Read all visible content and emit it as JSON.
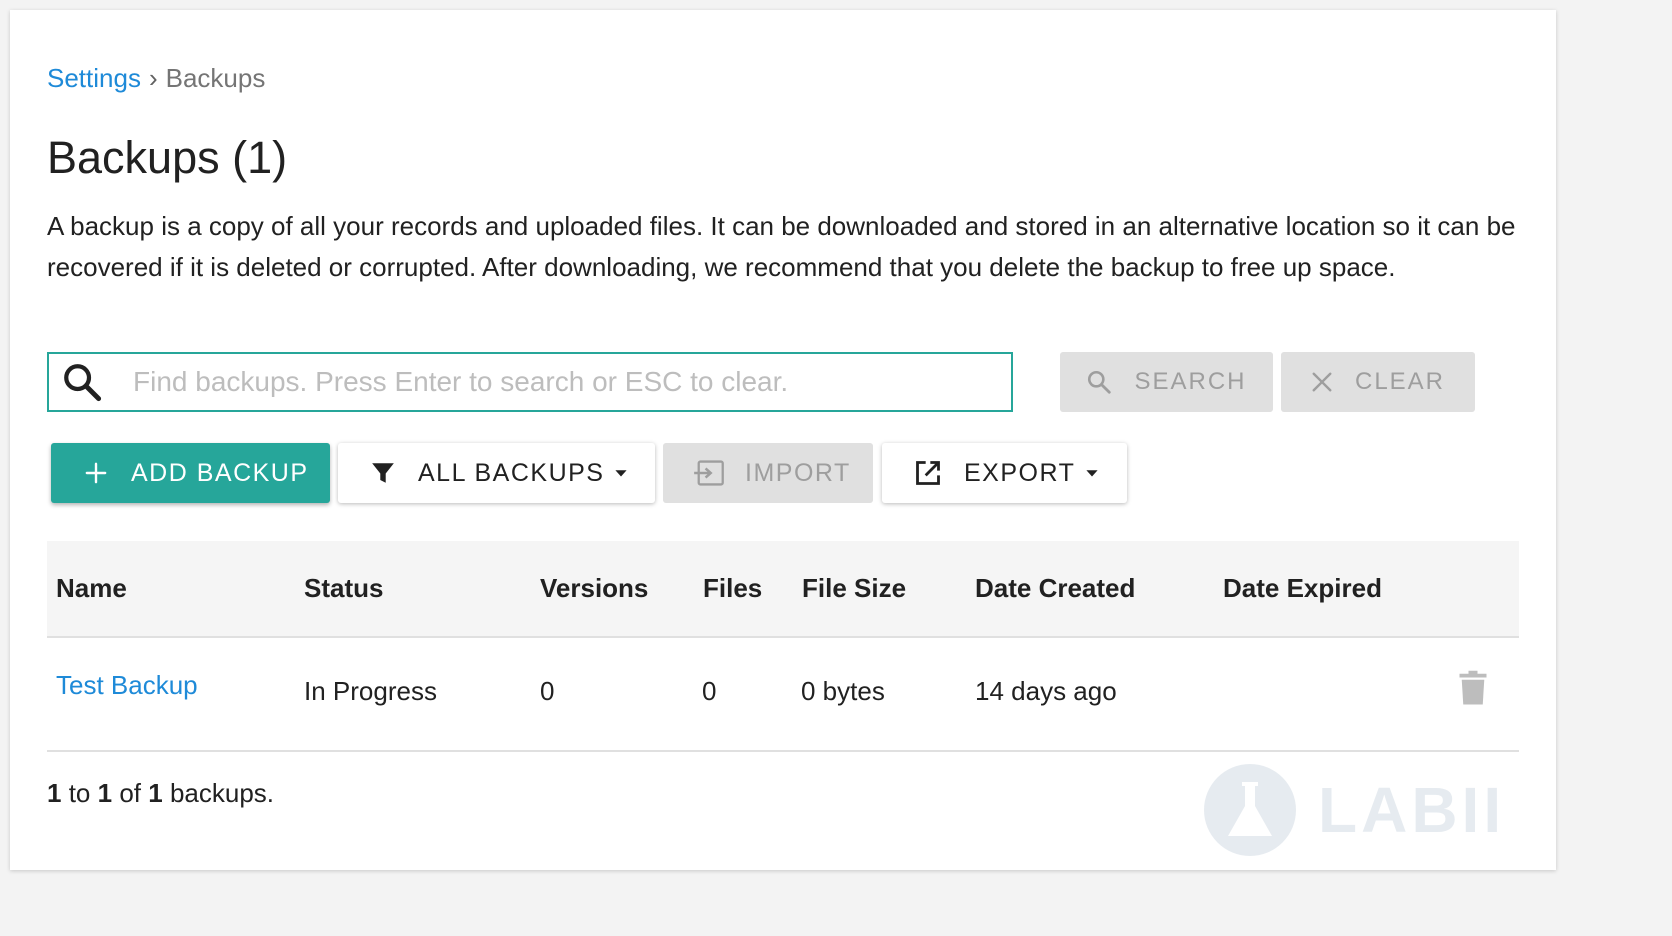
{
  "breadcrumb": {
    "parent": "Settings",
    "separator": "›",
    "current": "Backups"
  },
  "page": {
    "title": "Backups (1)",
    "description": "A backup is a copy of all your records and uploaded files. It can be downloaded and stored in an alternative location so it can be recovered if it is deleted or corrupted. After downloading, we recommend that you delete the backup to free up space."
  },
  "search": {
    "placeholder": "Find backups. Press Enter to search or ESC to clear.",
    "value": "",
    "search_label": "SEARCH",
    "clear_label": "CLEAR"
  },
  "toolbar": {
    "add_label": "ADD BACKUP",
    "filter_label": "ALL BACKUPS",
    "import_label": "IMPORT",
    "export_label": "EXPORT"
  },
  "table": {
    "columns": [
      "Name",
      "Status",
      "Versions",
      "Files",
      "File Size",
      "Date Created",
      "Date Expired"
    ],
    "rows": [
      {
        "name": "Test Backup",
        "status": "In Progress",
        "versions": "0",
        "files": "0",
        "file_size": "0 bytes",
        "date_created": "14 days ago",
        "date_expired": ""
      }
    ]
  },
  "footer": {
    "from": "1",
    "to_word": "to",
    "to": "1",
    "of_word": "of",
    "total": "1",
    "suffix": "backups."
  },
  "watermark": {
    "text": "LABII"
  },
  "colors": {
    "accent": "#26a69a",
    "link": "#1e8ad8",
    "disabled_bg": "#e0e0e0",
    "disabled_text": "#9e9e9e"
  },
  "icons": {
    "search": "search-icon",
    "clear": "close-icon",
    "add": "plus-icon",
    "filter": "filter-icon",
    "import": "import-icon",
    "export": "export-icon",
    "dropdown": "caret-down-icon",
    "delete": "trash-icon"
  }
}
